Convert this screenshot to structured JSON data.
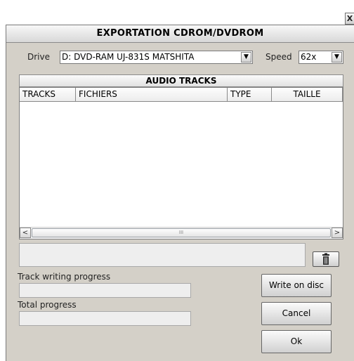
{
  "window": {
    "close_label": "X",
    "title": "EXPORTATION CDROM/DVDROM"
  },
  "drive": {
    "label": "Drive",
    "value": "D: DVD-RAM UJ-831S  MATSHITA"
  },
  "speed": {
    "label": "Speed",
    "value": "62x"
  },
  "tracks": {
    "header": "AUDIO TRACKS",
    "columns": [
      "TRACKS",
      "FICHIERS",
      "TYPE",
      "TAILLE"
    ],
    "rows": []
  },
  "scroll": {
    "left": "<",
    "right": ">",
    "grip": "III"
  },
  "progress": {
    "track_label": "Track writing progress",
    "track_value": 0,
    "total_label": "Total progress",
    "total_value": 0
  },
  "buttons": {
    "write": "Write on disc",
    "cancel": "Cancel",
    "ok": "Ok"
  },
  "icons": {
    "dropdown": "chevron-down-icon",
    "trash": "trash-icon",
    "close": "close-icon"
  }
}
